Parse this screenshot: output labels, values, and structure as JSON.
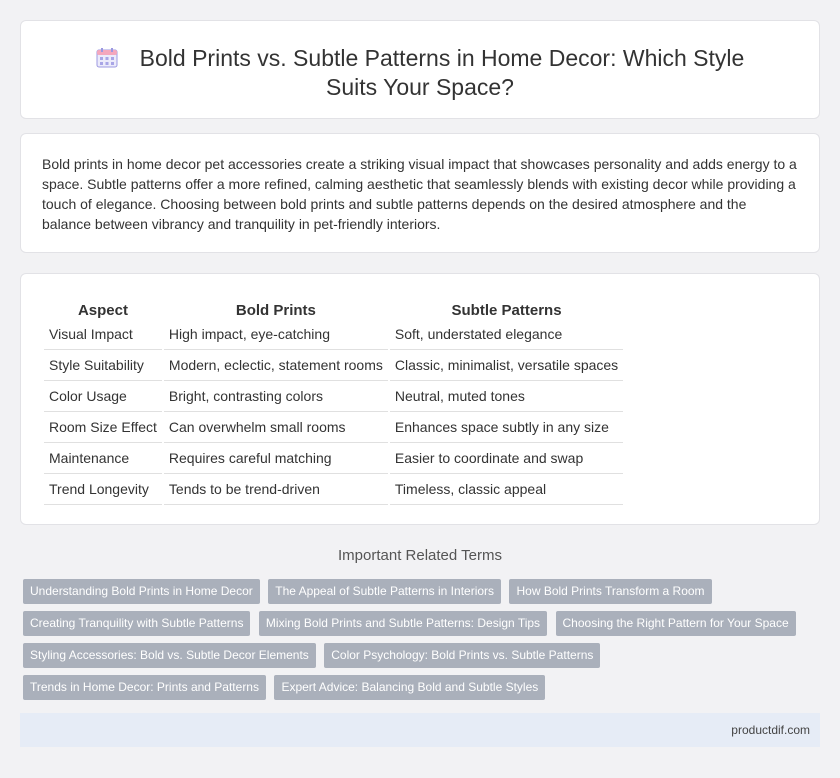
{
  "header": {
    "icon": "calendar-icon",
    "title": "Bold Prints vs. Subtle Patterns in Home Decor: Which Style Suits Your Space?"
  },
  "intro": {
    "text": "Bold prints in home decor pet accessories create a striking visual impact that showcases personality and adds energy to a space. Subtle patterns offer a more refined, calming aesthetic that seamlessly blends with existing decor while providing a touch of elegance. Choosing between bold prints and subtle patterns depends on the desired atmosphere and the balance between vibrancy and tranquility in pet-friendly interiors."
  },
  "comparison": {
    "headers": [
      "Aspect",
      "Bold Prints",
      "Subtle Patterns"
    ],
    "rows": [
      [
        "Visual Impact",
        "High impact, eye-catching",
        "Soft, understated elegance"
      ],
      [
        "Style Suitability",
        "Modern, eclectic, statement rooms",
        "Classic, minimalist, versatile spaces"
      ],
      [
        "Color Usage",
        "Bright, contrasting colors",
        "Neutral, muted tones"
      ],
      [
        "Room Size Effect",
        "Can overwhelm small rooms",
        "Enhances space subtly in any size"
      ],
      [
        "Maintenance",
        "Requires careful matching",
        "Easier to coordinate and swap"
      ],
      [
        "Trend Longevity",
        "Tends to be trend-driven",
        "Timeless, classic appeal"
      ]
    ]
  },
  "related": {
    "title": "Important Related Terms",
    "tags": [
      "Understanding Bold Prints in Home Decor",
      "The Appeal of Subtle Patterns in Interiors",
      "How Bold Prints Transform a Room",
      "Creating Tranquility with Subtle Patterns",
      "Mixing Bold Prints and Subtle Patterns: Design Tips",
      "Choosing the Right Pattern for Your Space",
      "Styling Accessories: Bold vs. Subtle Decor Elements",
      "Color Psychology: Bold Prints vs. Subtle Patterns",
      "Trends in Home Decor: Prints and Patterns",
      "Expert Advice: Balancing Bold and Subtle Styles"
    ]
  },
  "footer": {
    "site": "productdif.com"
  },
  "colors": {
    "background": "#f2f2f4",
    "tag_bg": "#aab0bb",
    "footer_bg": "#e6ecf6",
    "icon_accent": "#8e8ad8",
    "icon_header": "#f0a0b8"
  }
}
